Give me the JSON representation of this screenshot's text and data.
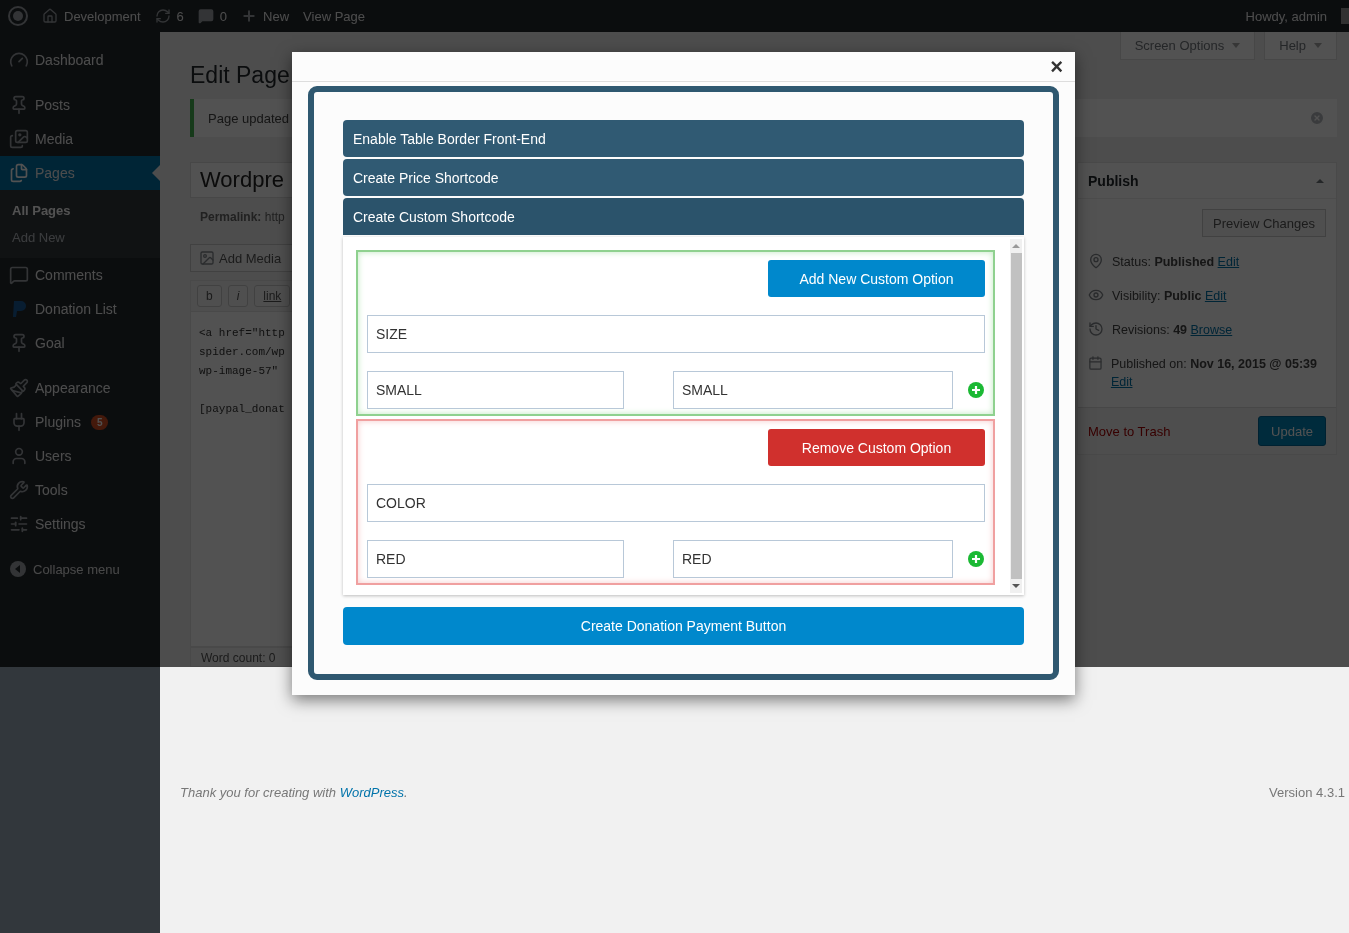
{
  "admin_bar": {
    "site": "Development",
    "updates": "6",
    "comments": "0",
    "new": "New",
    "view": "View Page",
    "greeting": "Howdy, admin"
  },
  "sidebar": {
    "groups": [
      {
        "items": [
          {
            "label": "Dashboard",
            "selected": false
          }
        ]
      },
      {
        "items": [
          {
            "label": "Posts",
            "selected": false
          },
          {
            "label": "Media",
            "selected": false
          },
          {
            "label": "Pages",
            "selected": true,
            "children": [
              {
                "label": "All Pages",
                "selected": true
              },
              {
                "label": "Add New",
                "selected": false
              }
            ]
          },
          {
            "label": "Comments",
            "selected": false
          },
          {
            "label": "Donation List",
            "selected": false
          },
          {
            "label": "Goal",
            "selected": false
          }
        ]
      },
      {
        "items": [
          {
            "label": "Appearance",
            "selected": false
          },
          {
            "label": "Plugins",
            "selected": false,
            "badge": "5"
          },
          {
            "label": "Users",
            "selected": false
          },
          {
            "label": "Tools",
            "selected": false
          },
          {
            "label": "Settings",
            "selected": false
          }
        ]
      }
    ],
    "collapse": "Collapse menu"
  },
  "screen_tabs": [
    "Screen Options",
    "Help"
  ],
  "editor": {
    "heading": "Edit Page",
    "notice": "Page updated",
    "title": "Wordpre",
    "permalink_label": "Permalink:",
    "permalink": "http",
    "add_media": "Add Media",
    "format_buttons": [
      "b",
      "i",
      "link"
    ],
    "code_paragraphs": [
      [
        "<a href=\"http",
        "spider.com/wp",
        "wp-image-57\""
      ],
      [
        "[paypal_donat"
      ]
    ],
    "word_count": "Word count: 0"
  },
  "publish": {
    "title": "Publish",
    "preview": "Preview Changes",
    "rows": [
      {
        "text": "Status: **Published**",
        "link": "Edit"
      },
      {
        "text": "Visibility: **Public**",
        "link": "Edit"
      },
      {
        "text": "Revisions: **49**",
        "link": "Browse"
      },
      {
        "text": "Published on: **Nov 16, 2015 @ 05:39**",
        "link": "Edit"
      }
    ],
    "trash": "Move to Trash",
    "update": "Update"
  },
  "modal": {
    "close": "×",
    "sections": [
      {
        "label": "Enable Table Border Front-End",
        "expanded": false
      },
      {
        "label": "Create Price Shortcode",
        "expanded": false
      },
      {
        "label": "Create Custom Shortcode",
        "expanded": true
      }
    ],
    "option_groups": [
      {
        "kind": "add",
        "action": "Add New Custom Option",
        "name": "SIZE",
        "values": [
          "SMALL",
          "SMALL"
        ]
      },
      {
        "kind": "remove",
        "action": "Remove Custom Option",
        "name": "COLOR",
        "values": [
          "RED",
          "RED"
        ]
      }
    ],
    "submit": "Create Donation Payment Button"
  },
  "footer": {
    "thanks": "Thank you for creating with",
    "link": "WordPress",
    "period": ".",
    "version": "Version 4.3.1"
  }
}
